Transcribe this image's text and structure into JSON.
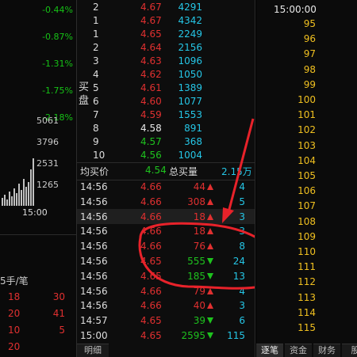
{
  "left": {
    "percents": [
      "-0.44%",
      "-0.87%",
      "-1.31%",
      "-1.75%",
      "-2.18%"
    ],
    "volumes": [
      "5061",
      "3796",
      "2531",
      "1265"
    ],
    "time_label": "15:00",
    "unit_label": "5手/笔",
    "rows": [
      {
        "a": "18",
        "b": "30"
      },
      {
        "a": "20",
        "b": "41"
      },
      {
        "a": "10",
        "b": "5"
      },
      {
        "a": "20",
        "b": ""
      }
    ]
  },
  "book": {
    "side_label": "买盘",
    "rows": [
      {
        "level": "2",
        "price": "4.67",
        "vol": "4291",
        "c": "red"
      },
      {
        "level": "1",
        "price": "4.67",
        "vol": "4342",
        "c": "red"
      },
      {
        "level": "1",
        "price": "4.65",
        "vol": "2249",
        "c": "red"
      },
      {
        "level": "2",
        "price": "4.64",
        "vol": "2156",
        "c": "red"
      },
      {
        "level": "3",
        "price": "4.63",
        "vol": "1096",
        "c": "red"
      },
      {
        "level": "4",
        "price": "4.62",
        "vol": "1050",
        "c": "red"
      },
      {
        "level": "5",
        "price": "4.61",
        "vol": "1389",
        "c": "red"
      },
      {
        "level": "6",
        "price": "4.60",
        "vol": "1077",
        "c": "red"
      },
      {
        "level": "7",
        "price": "4.59",
        "vol": "1553",
        "c": "red"
      },
      {
        "level": "8",
        "price": "4.58",
        "vol": "891",
        "c": "white"
      },
      {
        "level": "9",
        "price": "4.57",
        "vol": "368",
        "c": "green"
      },
      {
        "level": "10",
        "price": "4.56",
        "vol": "1004",
        "c": "green"
      }
    ],
    "avg_label": "均买价",
    "avg_value": "4.54",
    "total_label": "总买量",
    "total_value": "2.15万"
  },
  "trades": [
    {
      "time": "14:56",
      "price": "4.66",
      "vol": "44",
      "dir": "up",
      "n": "4"
    },
    {
      "time": "14:56",
      "price": "4.66",
      "vol": "308",
      "dir": "up",
      "n": "5"
    },
    {
      "time": "14:56",
      "price": "4.66",
      "vol": "18",
      "dir": "up",
      "n": "3"
    },
    {
      "time": "14:56",
      "price": "4.66",
      "vol": "18",
      "dir": "up",
      "n": "3"
    },
    {
      "time": "14:56",
      "price": "4.66",
      "vol": "76",
      "dir": "up",
      "n": "8"
    },
    {
      "time": "14:56",
      "price": "4.65",
      "vol": "555",
      "dir": "down",
      "n": "24"
    },
    {
      "time": "14:56",
      "price": "4.65",
      "vol": "185",
      "dir": "down",
      "n": "13"
    },
    {
      "time": "14:56",
      "price": "4.66",
      "vol": "79",
      "dir": "up",
      "n": "4"
    },
    {
      "time": "14:56",
      "price": "4.66",
      "vol": "40",
      "dir": "up",
      "n": "3"
    },
    {
      "time": "14:57",
      "price": "4.65",
      "vol": "39",
      "dir": "down",
      "n": "6"
    },
    {
      "time": "15:00",
      "price": "4.65",
      "vol": "2595",
      "dir": "down",
      "n": "115"
    }
  ],
  "mid_tab": "明细",
  "right": {
    "time": "15:00:00",
    "rows": [
      "95",
      "96",
      "97",
      "98",
      "99",
      "100",
      "101",
      "102",
      "103",
      "104",
      "105",
      "106",
      "107",
      "108",
      "109",
      "110",
      "111",
      "112",
      "113",
      "114",
      "115"
    ],
    "tabs": [
      "逐笔",
      "资金",
      "财务",
      "股"
    ]
  },
  "colors": {
    "red": "#e03030",
    "green": "#1ec21e",
    "cyan": "#25c6e6",
    "annotation": "#e8222a"
  }
}
